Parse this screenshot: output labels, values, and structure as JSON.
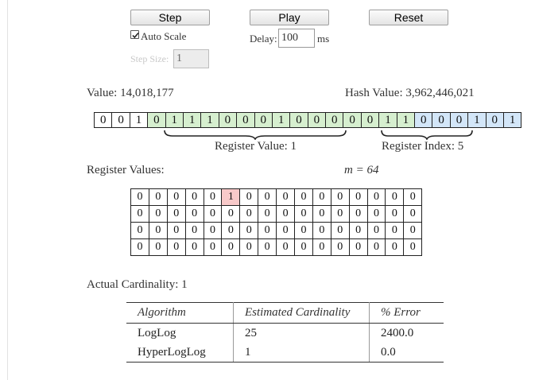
{
  "controls": {
    "step_label": "Step",
    "play_label": "Play",
    "reset_label": "Reset",
    "auto_scale_label": "Auto Scale",
    "auto_scale_checked": true,
    "delay_label": "Delay:",
    "delay_value": "100",
    "delay_unit": "ms",
    "step_size_label": "Step Size:",
    "step_size_value": "1"
  },
  "hash": {
    "value_label": "Value: 14,018,177",
    "hash_value_label": "Hash Value: 3,962,446,021",
    "bits": [
      "0",
      "0",
      "1",
      "0",
      "1",
      "1",
      "1",
      "0",
      "0",
      "0",
      "1",
      "0",
      "0",
      "0",
      "0",
      "0",
      "1",
      "1",
      "0",
      "0",
      "0",
      "1",
      "0",
      "1"
    ],
    "bit_groups": [
      "none",
      "none",
      "none",
      "green",
      "green",
      "green",
      "green",
      "green",
      "green",
      "green",
      "green",
      "green",
      "green",
      "green",
      "green",
      "green",
      "green",
      "green",
      "blue",
      "blue",
      "blue",
      "blue",
      "blue",
      "blue"
    ],
    "register_value_label": "Register Value: 1",
    "register_index_label": "Register Index: 5"
  },
  "registers": {
    "title": "Register Values:",
    "m_label": "m = 64",
    "rows": [
      [
        "0",
        "0",
        "0",
        "0",
        "0",
        "1",
        "0",
        "0",
        "0",
        "0",
        "0",
        "0",
        "0",
        "0",
        "0",
        "0"
      ],
      [
        "0",
        "0",
        "0",
        "0",
        "0",
        "0",
        "0",
        "0",
        "0",
        "0",
        "0",
        "0",
        "0",
        "0",
        "0",
        "0"
      ],
      [
        "0",
        "0",
        "0",
        "0",
        "0",
        "0",
        "0",
        "0",
        "0",
        "0",
        "0",
        "0",
        "0",
        "0",
        "0",
        "0"
      ],
      [
        "0",
        "0",
        "0",
        "0",
        "0",
        "0",
        "0",
        "0",
        "0",
        "0",
        "0",
        "0",
        "0",
        "0",
        "0",
        "0"
      ]
    ],
    "highlight_index": 5
  },
  "stats": {
    "actual_cardinality_label": "Actual Cardinality: 1"
  },
  "results": {
    "headers": [
      "Algorithm",
      "Estimated Cardinality",
      "% Error"
    ],
    "rows": [
      [
        "LogLog",
        "25",
        "2400.0"
      ],
      [
        "HyperLogLog",
        "1",
        "0.0"
      ]
    ]
  },
  "colors": {
    "green": "#d6efcf",
    "blue": "#d3e6f8",
    "highlight": "#f8c9c9"
  }
}
